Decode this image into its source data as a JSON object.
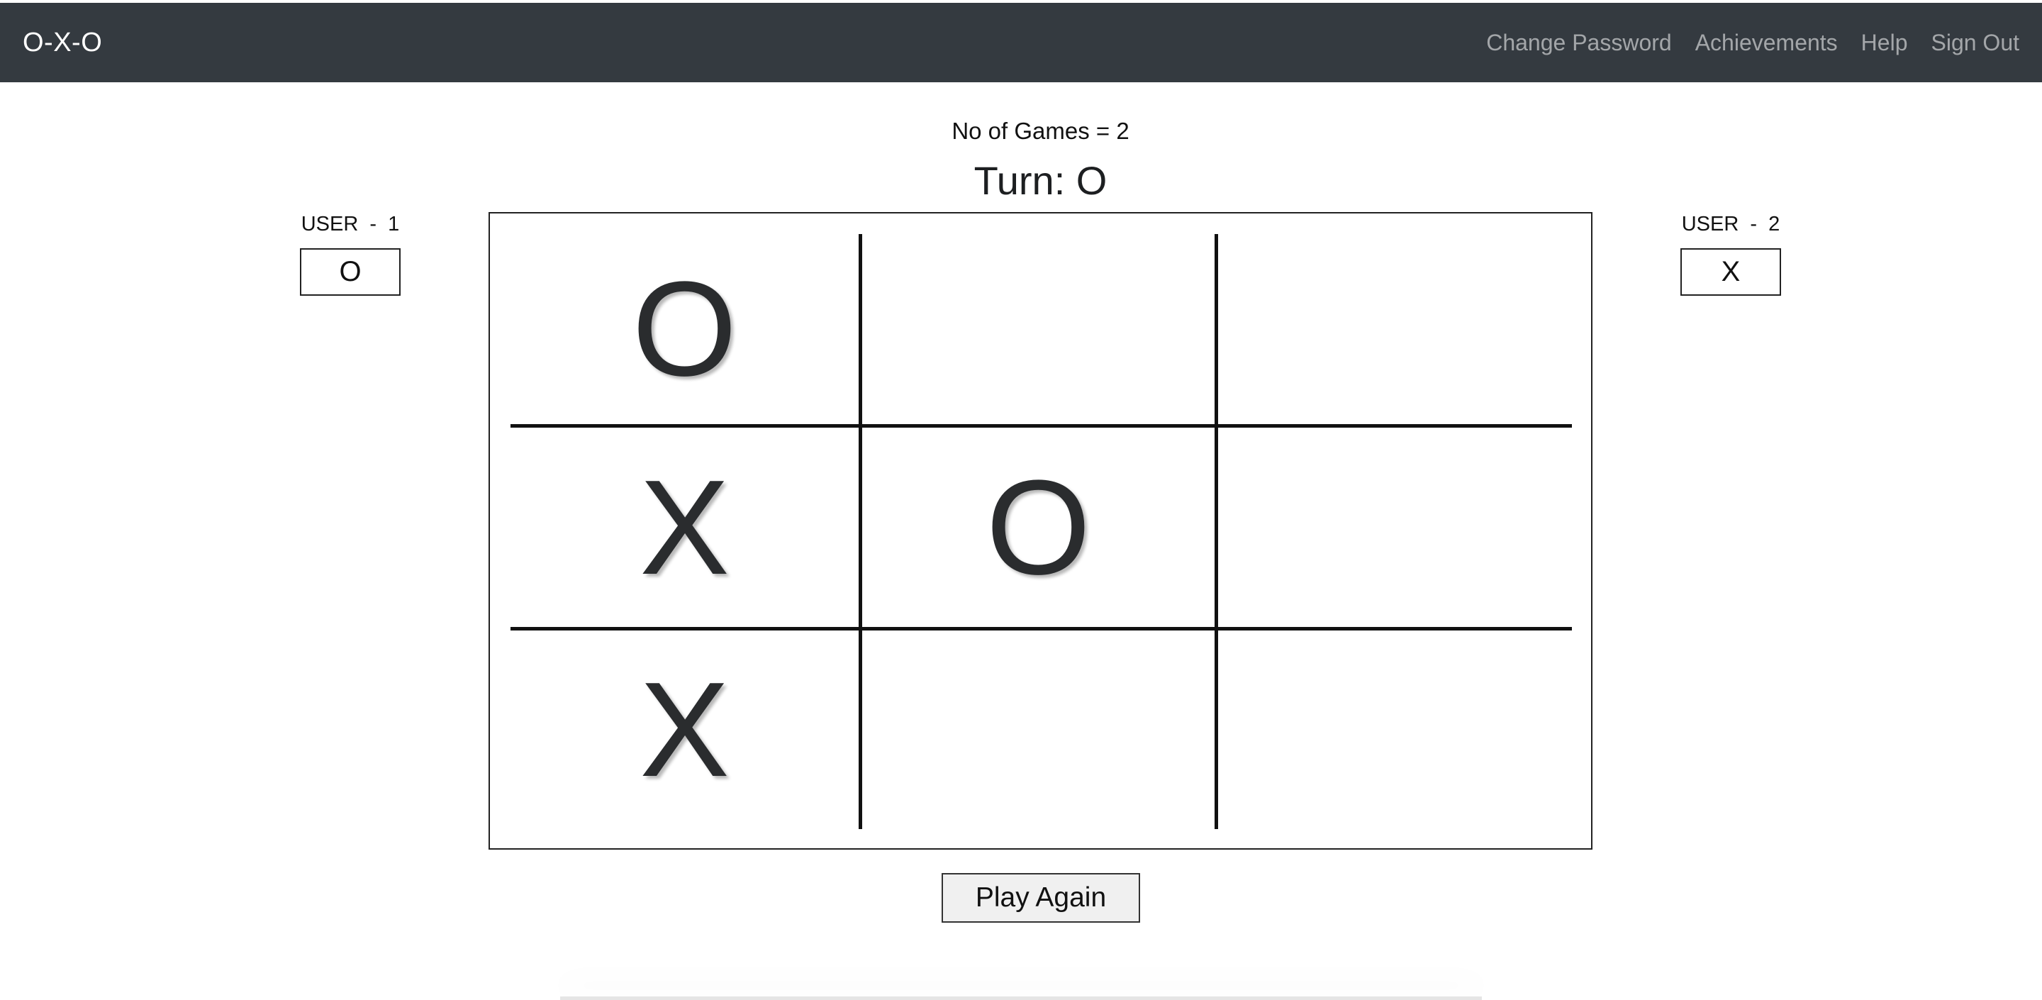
{
  "navbar": {
    "brand": "O-X-O",
    "links": [
      "Change Password",
      "Achievements",
      "Help",
      "Sign Out"
    ]
  },
  "status": {
    "games": "No of Games = 2",
    "turn": "Turn: O"
  },
  "players": [
    {
      "label": "USER  -  1",
      "mark": "O"
    },
    {
      "label": "USER  -  2",
      "mark": "X"
    }
  ],
  "board": {
    "cells": [
      "O",
      "",
      "",
      "X",
      "O",
      "",
      "X",
      "",
      ""
    ]
  },
  "actions": {
    "play_again": "Play Again"
  }
}
